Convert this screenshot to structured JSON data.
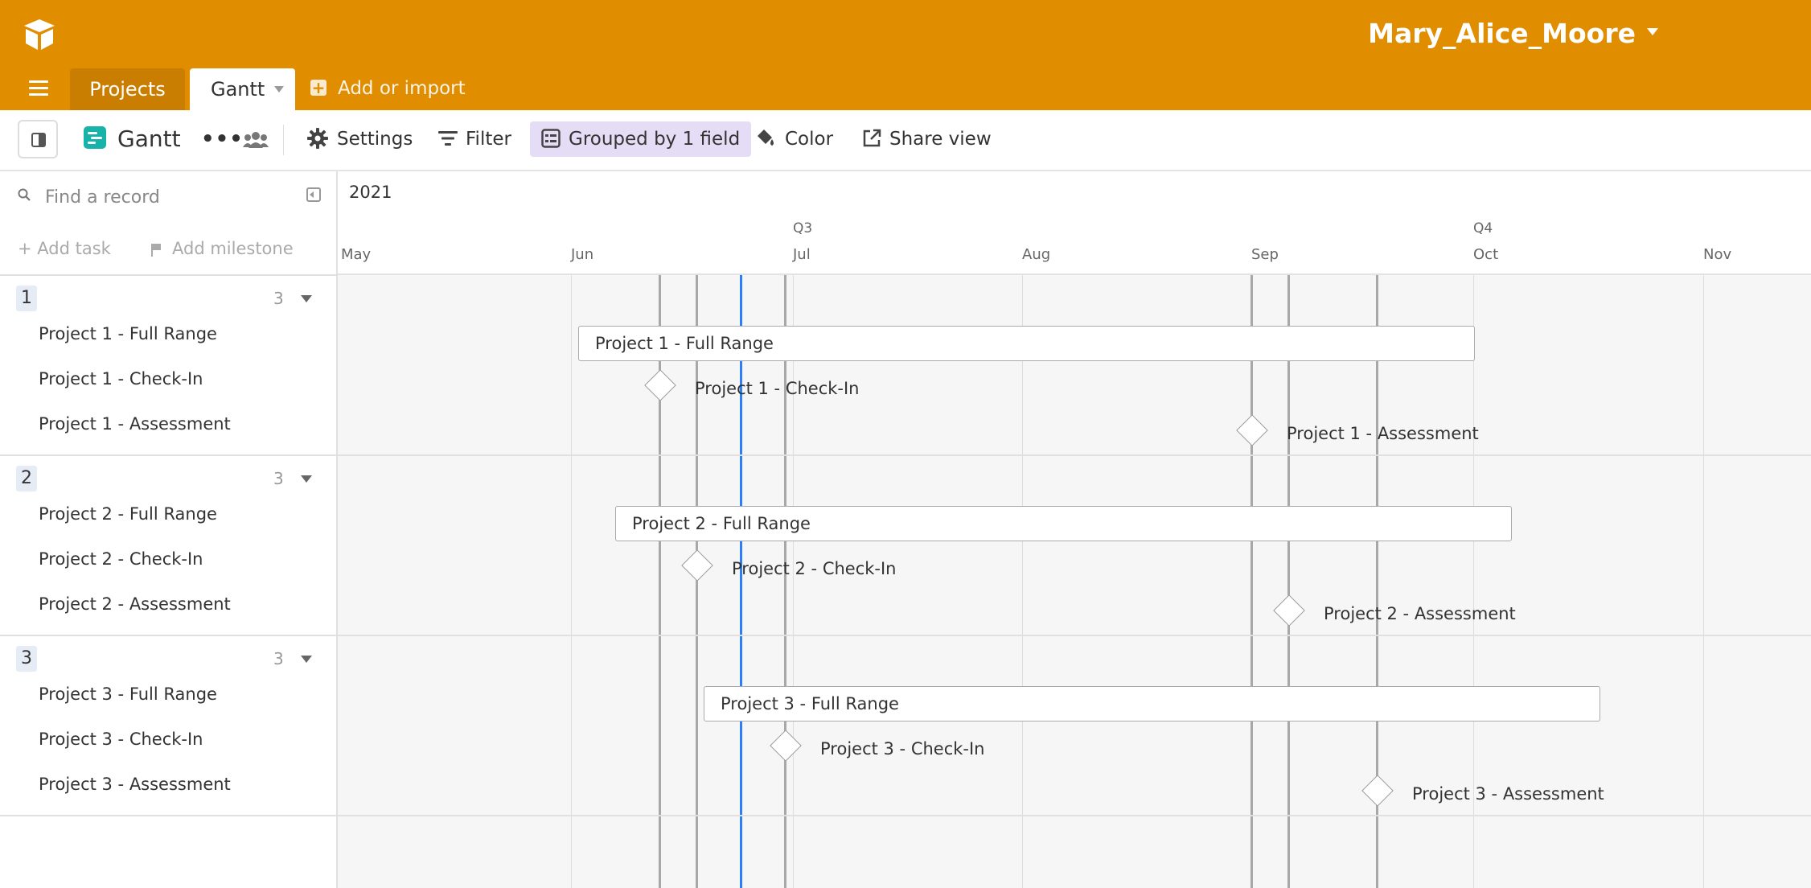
{
  "app": {
    "username": "Mary_Alice_Moore",
    "tabs": [
      {
        "label": "Projects"
      },
      {
        "label": "Gantt"
      }
    ],
    "add_import_label": "Add or import"
  },
  "toolbar": {
    "view_name": "Gantt",
    "more_label": "•••",
    "settings_label": "Settings",
    "filter_label": "Filter",
    "group_label": "Grouped by 1 field",
    "color_label": "Color",
    "share_label": "Share view"
  },
  "sidebar": {
    "search_placeholder": "Find a record",
    "add_task_label": "+ Add task",
    "add_milestone_label": "Add milestone",
    "groups": [
      {
        "name": "1",
        "count": "3",
        "rows": [
          "Project 1 - Full Range",
          "Project 1 - Check-In",
          "Project 1 - Assessment"
        ]
      },
      {
        "name": "2",
        "count": "3",
        "rows": [
          "Project 2 - Full Range",
          "Project 2 - Check-In",
          "Project 2 - Assessment"
        ]
      },
      {
        "name": "3",
        "count": "3",
        "rows": [
          "Project 3 - Full Range",
          "Project 3 - Check-In",
          "Project 3 - Assessment"
        ]
      }
    ]
  },
  "timeline": {
    "year": "2021",
    "quarters": [
      "Q3",
      "Q4"
    ],
    "months": [
      "May",
      "Jun",
      "Jul",
      "Aug",
      "Sep",
      "Oct",
      "Nov"
    ],
    "bars": [
      "Project 1 - Full Range",
      "Project 2 - Full Range",
      "Project 3 - Full Range"
    ],
    "milestones": [
      "Project 1 - Check-In",
      "Project 1 - Assessment",
      "Project 2 - Check-In",
      "Project 2 - Assessment",
      "Project 3 - Check-In",
      "Project 3 - Assessment"
    ]
  },
  "colors": {
    "header_bg": "#e08d00",
    "today_line": "#2d7ff9",
    "group_button_bg": "#e5dcf5",
    "view_icon": "#18b3a8"
  },
  "icons": [
    "logo-icon",
    "menu-icon",
    "plus-icon",
    "sidebar-toggle-icon",
    "gantt-view-icon",
    "more-icon",
    "collaborators-icon",
    "gear-icon",
    "filter-icon",
    "group-icon",
    "paint-bucket-icon",
    "share-icon",
    "search-icon",
    "collapse-icon",
    "flag-icon",
    "chevron-down-icon"
  ]
}
